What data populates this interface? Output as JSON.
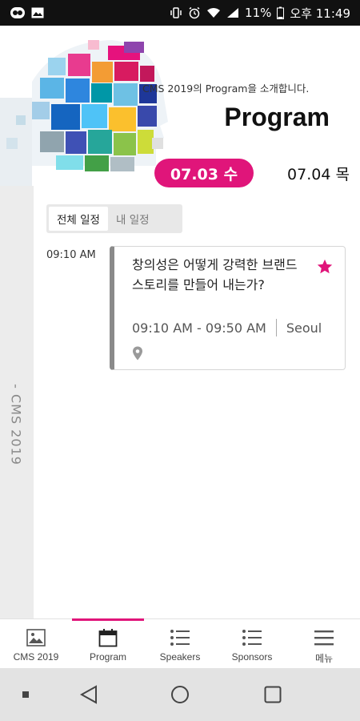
{
  "status_bar": {
    "battery_percent": "11%",
    "time": "오후 11:49",
    "left_icons": [
      "app-badge-icon",
      "image-icon"
    ],
    "right_icons": [
      "vibrate-icon",
      "alarm-icon",
      "wifi-icon",
      "signal-icon",
      "battery-icon"
    ]
  },
  "header": {
    "subtitle": "CMS 2019의 Program을 소개합니다.",
    "title": "Program"
  },
  "side_rail": {
    "label": "- CMS 2019"
  },
  "date_tabs": [
    {
      "label": "07.03 수",
      "selected": true
    },
    {
      "label": "07.04 목",
      "selected": false
    }
  ],
  "schedule_filter": [
    {
      "label": "전체 일정",
      "selected": true
    },
    {
      "label": "내 일정",
      "selected": false
    }
  ],
  "sessions": [
    {
      "time": "09:10 AM",
      "title": "창의성은 어떻게 강력한 브랜드 스토리를 만들어 내는가?",
      "time_range": "09:10 AM - 09:50 AM",
      "location": "Seoul",
      "favorited": true
    }
  ],
  "bottom_nav": [
    {
      "label": "CMS 2019",
      "icon": "image-icon",
      "selected": false
    },
    {
      "label": "Program",
      "icon": "calendar-icon",
      "selected": true
    },
    {
      "label": "Speakers",
      "icon": "list-icon",
      "selected": false
    },
    {
      "label": "Sponsors",
      "icon": "list-icon",
      "selected": false
    },
    {
      "label": "메뉴",
      "icon": "hamburger-icon",
      "selected": false
    }
  ],
  "colors": {
    "accent": "#e0157a",
    "status_bar_bg": "#111111",
    "side_rail_bg": "#ececec",
    "system_nav_bg": "#e3e3e3"
  }
}
